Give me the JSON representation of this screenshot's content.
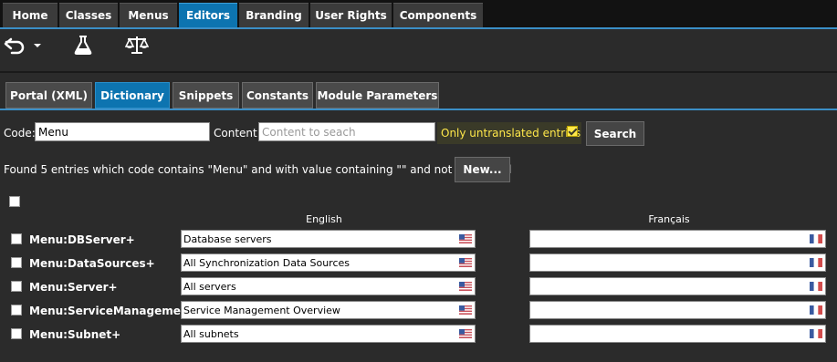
{
  "topnav": {
    "tabs": [
      {
        "label": "Home"
      },
      {
        "label": "Classes"
      },
      {
        "label": "Menus"
      },
      {
        "label": "Editors"
      },
      {
        "label": "Branding"
      },
      {
        "label": "User Rights"
      },
      {
        "label": "Components"
      }
    ],
    "active": "Editors"
  },
  "toolbar": {
    "icons": [
      "undo-dropdown-icon",
      "flask-icon",
      "balance-scale-icon"
    ]
  },
  "subtabs": {
    "tabs": [
      {
        "label": "Portal (XML)"
      },
      {
        "label": "Dictionary"
      },
      {
        "label": "Snippets"
      },
      {
        "label": "Constants"
      },
      {
        "label": "Module Parameters"
      }
    ],
    "active": "Dictionary"
  },
  "search": {
    "code_label": "Code:",
    "code_value": "Menu",
    "content_label": "Content:",
    "content_placeholder": "Content to seach",
    "untranslated_label": "Only untranslated entries",
    "untranslated_checked": true,
    "search_button": "Search"
  },
  "results": {
    "summary": "Found 5 entries which code contains \"Menu\" and with value containing \"\" and not translated",
    "new_button": "New..."
  },
  "table": {
    "columns": [
      "English",
      "Français"
    ],
    "rows": [
      {
        "code": "Menu:DBServer+",
        "english": "Database servers",
        "french": ""
      },
      {
        "code": "Menu:DataSources+",
        "english": "All Synchronization Data Sources",
        "french": ""
      },
      {
        "code": "Menu:Server+",
        "english": "All servers",
        "french": ""
      },
      {
        "code": "Menu:ServiceManagement+",
        "english": "Service Management Overview",
        "french": ""
      },
      {
        "code": "Menu:Subnet+",
        "english": "All subnets",
        "french": ""
      }
    ]
  },
  "colors": {
    "accent": "#0d74b0",
    "highlight_text": "#ffe84a",
    "background": "#2b2b2b"
  }
}
